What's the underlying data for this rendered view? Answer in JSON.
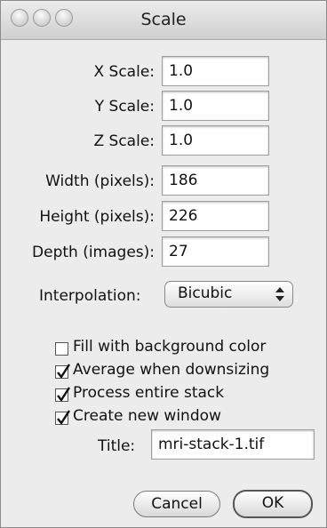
{
  "window": {
    "title": "Scale"
  },
  "fields": [
    {
      "label": "X Scale:",
      "value": "1.0"
    },
    {
      "label": "Y Scale:",
      "value": "1.0"
    },
    {
      "label": "Z Scale:",
      "value": "1.0"
    },
    {
      "label": "Width (pixels):",
      "value": "186"
    },
    {
      "label": "Height (pixels):",
      "value": "226"
    },
    {
      "label": "Depth (images):",
      "value": "27"
    }
  ],
  "interpolation": {
    "label": "Interpolation:",
    "value": "Bicubic"
  },
  "options": [
    {
      "label": "Fill with background color",
      "checked": false
    },
    {
      "label": "Average when downsizing",
      "checked": true
    },
    {
      "label": "Process entire stack",
      "checked": true
    },
    {
      "label": "Create new window",
      "checked": true
    }
  ],
  "title_field": {
    "label": "Title:",
    "value": "mri-stack-1.tif"
  },
  "buttons": {
    "cancel": "Cancel",
    "ok": "OK"
  }
}
